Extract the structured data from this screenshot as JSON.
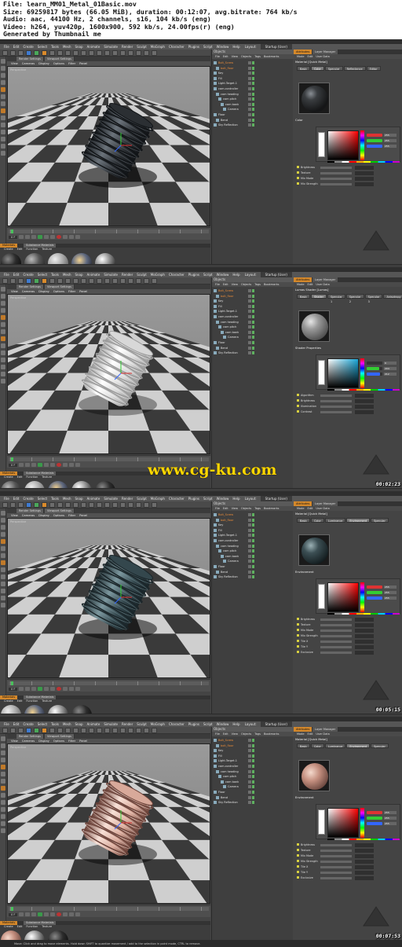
{
  "header": {
    "file": "File: learn_MM01_Metal_01Basic.mov",
    "size": "Size: 69259817 bytes (66.05 MiB), duration: 00:12:07, avg.bitrate: 764 kb/s",
    "audio": "Audio: aac, 44100 Hz, 2 channels, s16, 104 kb/s (eng)",
    "video": "Video: h264, yuv420p, 1600x900, 592 kb/s, 24.00fps(r) (eng)",
    "generator": "Generated by Thumbnail me"
  },
  "watermark": "www.cg-ku.com",
  "menu": [
    "File",
    "Edit",
    "Create",
    "Select",
    "Tools",
    "Mesh",
    "Snap",
    "Animate",
    "Simulate",
    "Render",
    "Sculpt",
    "MoGraph",
    "Character",
    "Plugins",
    "Script",
    "Window",
    "Help"
  ],
  "layout_label": "Layout:",
  "layout_value": "Startup (User)",
  "viewport": {
    "tabs": [
      "Render Settings",
      "Viewport Settings"
    ],
    "menu": [
      "View",
      "Cameras",
      "Display",
      "Options",
      "Filter",
      "Panel"
    ],
    "label": "Perspective"
  },
  "timeline": {
    "ticks": [
      "0",
      "10",
      "20",
      "30",
      "40",
      "50",
      "60",
      "70",
      "80",
      "90"
    ],
    "frame": "0 F"
  },
  "materials": {
    "tabs": [
      "Materials",
      "Substance Materials"
    ],
    "menu": [
      "Create",
      "Edit",
      "Function",
      "Texture"
    ],
    "selected_label": "Quick Metal"
  },
  "objects": {
    "title": "Objects",
    "menu": [
      "File",
      "Edit",
      "View",
      "Objects",
      "Tags",
      "Bookmarks"
    ],
    "rows": [
      {
        "name": "Bolt_Screw",
        "hl": true,
        "indent": 0
      },
      {
        "name": "bolt_floor",
        "hl": true,
        "indent": 1
      },
      {
        "name": "Key",
        "hl": false,
        "indent": 0
      },
      {
        "name": "Fill",
        "hl": false,
        "indent": 0
      },
      {
        "name": "Light.Target.1",
        "hl": false,
        "indent": 0
      },
      {
        "name": "cam.controller",
        "hl": false,
        "indent": 0
      },
      {
        "name": "cam heading",
        "hl": false,
        "indent": 1
      },
      {
        "name": "cam pitch",
        "hl": false,
        "indent": 2
      },
      {
        "name": "cam bank",
        "hl": false,
        "indent": 3
      },
      {
        "name": "Camera",
        "hl": false,
        "indent": 4
      },
      {
        "name": "Floor",
        "hl": false,
        "indent": 0
      },
      {
        "name": "Bend",
        "hl": false,
        "indent": 1
      },
      {
        "name": "Sky Reflection",
        "hl": false,
        "indent": 0
      }
    ]
  },
  "attributes": {
    "tabs": [
      "Attributes",
      "Layer Manager"
    ],
    "menu": [
      "Mode",
      "Edit",
      "User Data"
    ]
  },
  "frames": [
    {
      "timestamp": "",
      "material_name": "Material [Quick Metal]",
      "tabs": [
        "Basic",
        "Color",
        "Specular",
        "Reflectance",
        "Editor"
      ],
      "active_tab": 1,
      "section": "Color",
      "color_values": [
        "255",
        "255",
        "255"
      ],
      "props": [
        "Brightness",
        "Texture",
        "Mix Mode",
        "Mix Strength"
      ],
      "ball_style": "dark",
      "object_style": "dark",
      "mat_labels": [
        "Quick Metal",
        "",
        "",
        "",
        ""
      ]
    },
    {
      "timestamp": "00:02:23",
      "material_name": "Lumas Shader [Lumas]",
      "tabs": [
        "Basic",
        "Shader",
        "Specular 1",
        "Specular 2",
        "Specular 3",
        "Anisotropy"
      ],
      "active_tab": 1,
      "section": "Shader Properties",
      "color_values": [
        "0",
        "204",
        "212"
      ],
      "props": [
        "Algorithm",
        "Brightness",
        "Illumination",
        "Contrast"
      ],
      "ball_style": "grey",
      "object_style": "white",
      "mat_labels": [
        "Quick Metal",
        "",
        "",
        "",
        ""
      ]
    },
    {
      "timestamp": "00:05:15",
      "material_name": "Material [Quick Metal]",
      "tabs": [
        "Basic",
        "Color",
        "Luminance",
        "Environment",
        "Specular"
      ],
      "active_tab": 3,
      "section": "Environment",
      "color_values": [
        "255",
        "255",
        "255"
      ],
      "props": [
        "Brightness",
        "Texture",
        "Mix Mode",
        "Mix Strength",
        "Tile X",
        "Tile Y",
        "Exclusive"
      ],
      "ball_style": "teal",
      "object_style": "teal",
      "mat_labels": [
        "Quick Metal",
        "",
        "",
        ""
      ]
    },
    {
      "timestamp": "00:07:53",
      "material_name": "Material [Quick Metal]",
      "tabs": [
        "Basic",
        "Color",
        "Luminance",
        "Environment",
        "Specular"
      ],
      "active_tab": 3,
      "section": "Environment",
      "color_values": [
        "255",
        "255",
        "255"
      ],
      "props": [
        "Brightness",
        "Texture",
        "Mix Mode",
        "Mix Strength",
        "Tile X",
        "Tile Y",
        "Exclusive"
      ],
      "ball_style": "copper",
      "object_style": "copper",
      "mat_labels": [
        "Quick Metal",
        "",
        ""
      ]
    }
  ],
  "final_timestamp": "00:10:30",
  "status_text": "Move: Click and drag to move elements. Hold down SHIFT to quantize movement / add to the selection in point mode, CTRL to remove."
}
